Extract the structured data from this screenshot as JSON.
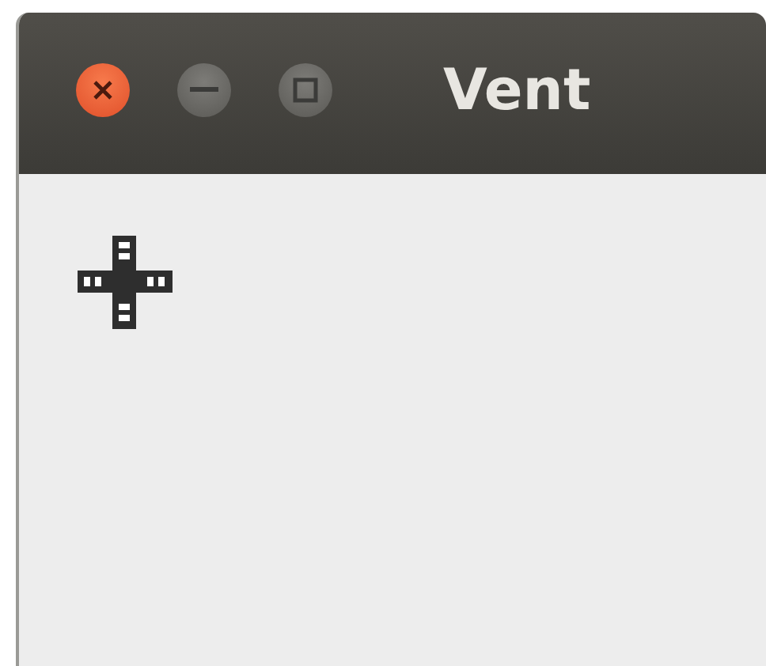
{
  "window": {
    "title": "Vent"
  }
}
